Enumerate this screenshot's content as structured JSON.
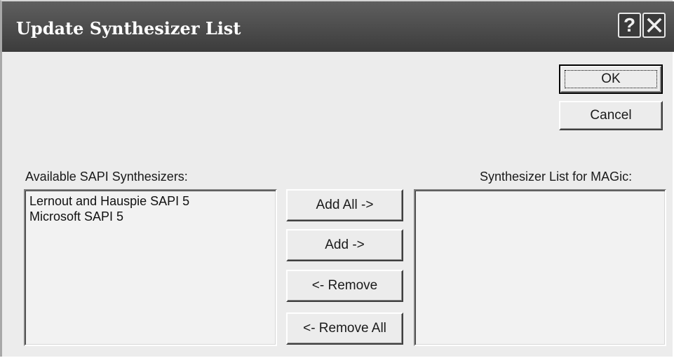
{
  "dialog": {
    "title": "Update Synthesizer List",
    "help_glyph": "?",
    "close_glyph": "close"
  },
  "buttons": {
    "ok": {
      "prefix": "",
      "accel": "O",
      "suffix": "K"
    },
    "cancel": {
      "prefix": "",
      "accel": "C",
      "suffix": "ancel"
    },
    "add_all": {
      "prefix": "A",
      "accel": "d",
      "suffix": "d All  ->"
    },
    "add": {
      "prefix": "",
      "accel": "A",
      "suffix": "dd  ->"
    },
    "remove": {
      "prefix": "<-  ",
      "accel": "R",
      "suffix": "emove"
    },
    "remove_all": {
      "prefix": "<-  Re",
      "accel": "m",
      "suffix": "ove All"
    }
  },
  "available": {
    "label_prefix": "Available ",
    "label_accel": "S",
    "label_suffix": "API Synthesizers:",
    "items": [
      "Lernout and Hauspie SAPI 5",
      "Microsoft SAPI 5"
    ]
  },
  "magic": {
    "label_prefix": "Synthesizer ",
    "label_accel": "L",
    "label_suffix": "ist for MAGic:",
    "items": []
  }
}
